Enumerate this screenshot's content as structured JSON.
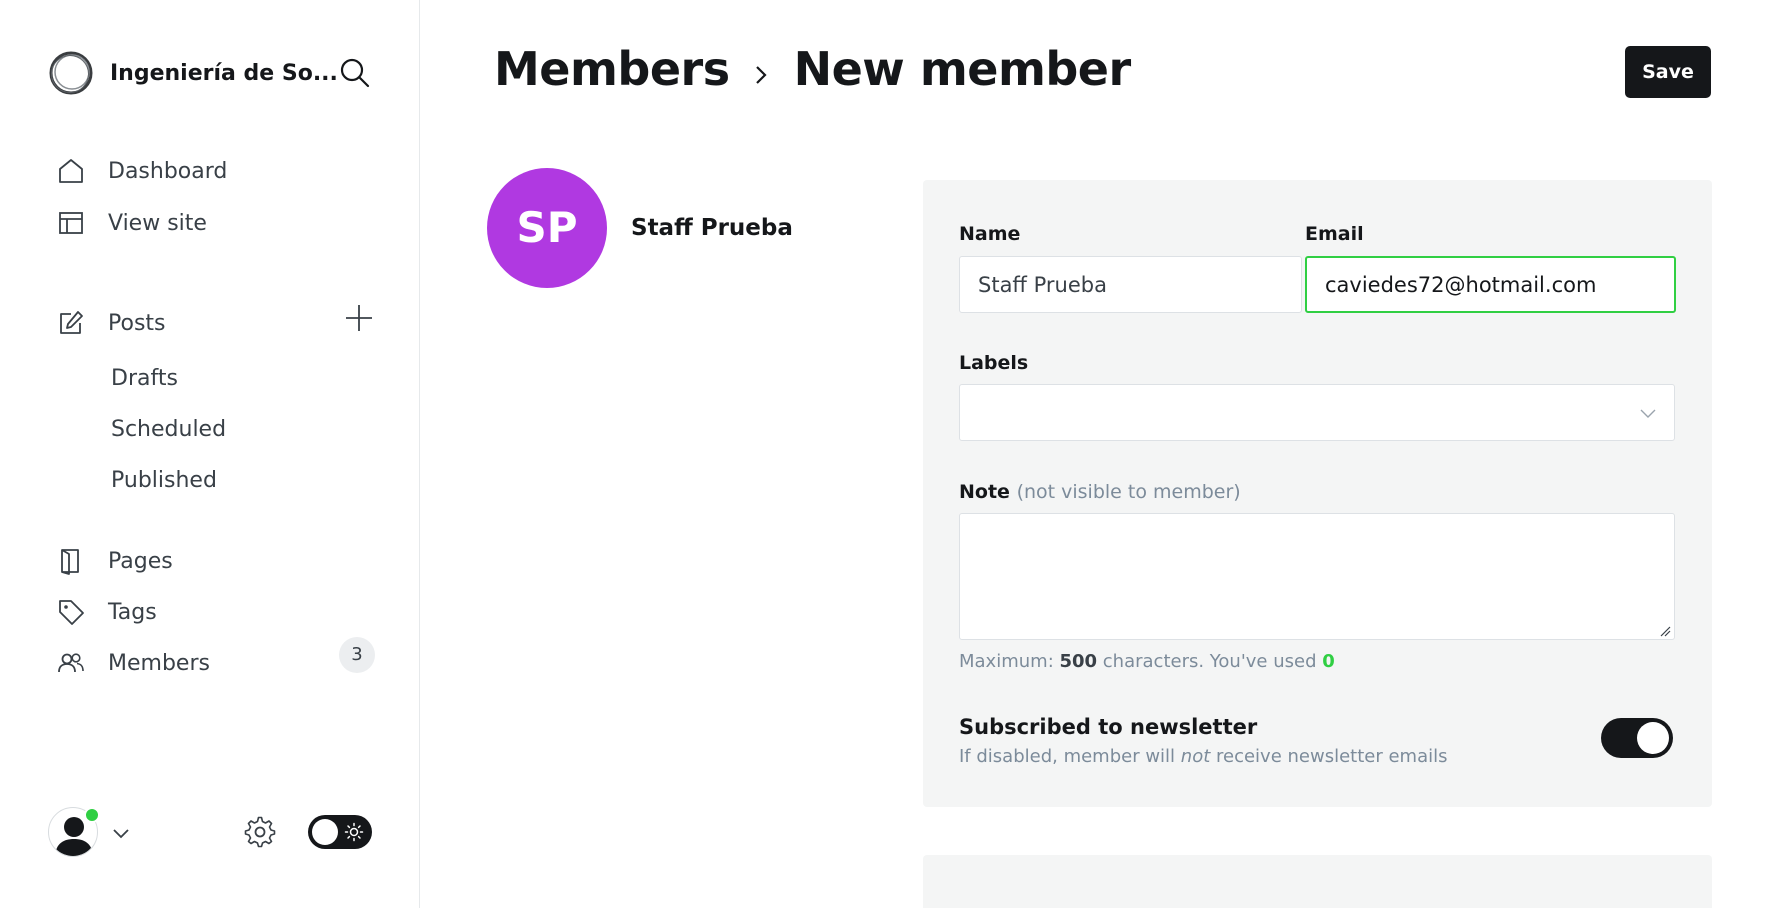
{
  "sidebar": {
    "site_title": "Ingeniería de So...",
    "nav": {
      "dashboard": "Dashboard",
      "view_site": "View site",
      "posts": "Posts",
      "drafts": "Drafts",
      "scheduled": "Scheduled",
      "published": "Published",
      "pages": "Pages",
      "tags": "Tags",
      "members": "Members",
      "members_count": "3"
    },
    "icons": [
      "brand-logo-icon",
      "search-icon",
      "home-icon",
      "layout-icon",
      "edit-icon",
      "plus-icon",
      "book-icon",
      "tag-icon",
      "users-icon",
      "chevron-down-icon",
      "gear-icon",
      "sun-icon"
    ]
  },
  "header": {
    "breadcrumb_parent": "Members",
    "breadcrumb_current": "New member",
    "save_label": "Save"
  },
  "member": {
    "initials": "SP",
    "display_name": "Staff Prueba",
    "avatar_color": "#b039e1"
  },
  "form": {
    "name_label": "Name",
    "name_value": "Staff Prueba",
    "email_label": "Email",
    "email_value": "caviedes72@hotmail.com",
    "labels_label": "Labels",
    "note_label": "Note",
    "note_hint": "(not visible to member)",
    "note_value": "",
    "char_prefix": "Maximum: ",
    "char_max": "500",
    "char_middle": " characters. You've used ",
    "char_used": "0",
    "newsletter_title": "Subscribed to newsletter",
    "newsletter_desc_1": "If disabled, member will ",
    "newsletter_desc_em": "not",
    "newsletter_desc_2": " receive newsletter emails",
    "newsletter_enabled": true
  },
  "colors": {
    "accent_green": "#30cf43",
    "primary_dark": "#15171a"
  }
}
